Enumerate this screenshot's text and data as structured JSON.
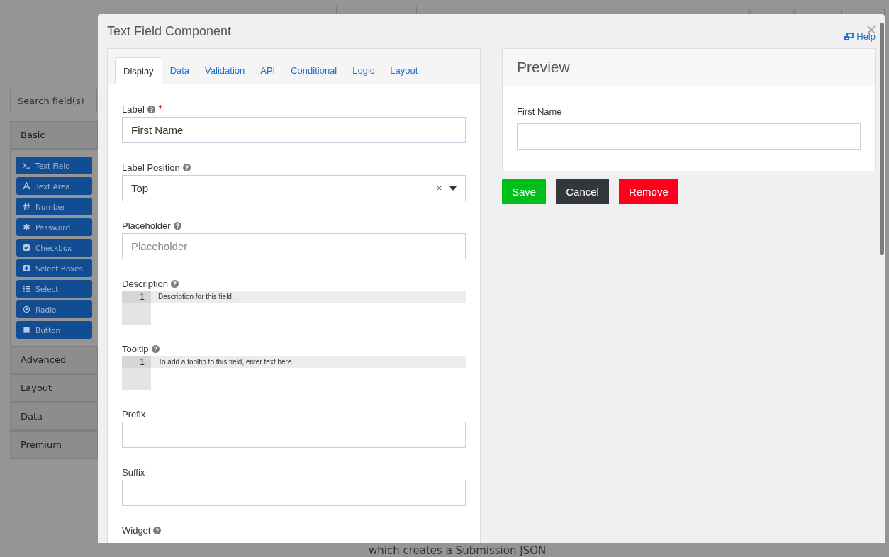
{
  "builder": {
    "search": {
      "placeholder": "Search field(s)"
    },
    "groups": [
      {
        "label": "Basic",
        "items": [
          {
            "label": "Text Field"
          },
          {
            "label": "Text Area"
          },
          {
            "label": "Number"
          },
          {
            "label": "Password"
          },
          {
            "label": "Checkbox"
          },
          {
            "label": "Select Boxes"
          },
          {
            "label": "Select"
          },
          {
            "label": "Radio"
          },
          {
            "label": "Button"
          }
        ]
      },
      {
        "label": "Advanced"
      },
      {
        "label": "Layout"
      },
      {
        "label": "Data"
      },
      {
        "label": "Premium"
      }
    ],
    "footer_text": "which creates a Submission JSON"
  },
  "dialog": {
    "title": "Text Field Component",
    "help_link": "Help",
    "tabs": [
      {
        "label": "Display",
        "selected": true
      },
      {
        "label": "Data",
        "selected": false
      },
      {
        "label": "Validation",
        "selected": false
      },
      {
        "label": "API",
        "selected": false
      },
      {
        "label": "Conditional",
        "selected": false
      },
      {
        "label": "Logic",
        "selected": false
      },
      {
        "label": "Layout",
        "selected": false
      }
    ],
    "fields": [
      {
        "kind": "input",
        "label": "Label",
        "help": true,
        "required": true,
        "value": "First Name"
      },
      {
        "kind": "select",
        "label": "Label Position",
        "help": true,
        "value": "Top"
      },
      {
        "kind": "input",
        "label": "Placeholder",
        "help": true,
        "placeholder": "Placeholder"
      },
      {
        "kind": "code",
        "label": "Description",
        "help": true,
        "line_number": "1",
        "value": "Description for this field."
      },
      {
        "kind": "code",
        "label": "Tooltip",
        "help": true,
        "line_number": "1",
        "value": "To add a tooltip to this field, enter text here."
      },
      {
        "kind": "input",
        "label": "Prefix",
        "help": false
      },
      {
        "kind": "input",
        "label": "Suffix",
        "help": false
      },
      {
        "kind": "heading",
        "label": "Widget",
        "help": true
      }
    ],
    "preview": {
      "title": "Preview",
      "field_label": "First Name"
    },
    "buttons": [
      {
        "label": "Save",
        "kind": "success"
      },
      {
        "label": "Cancel",
        "kind": "dark"
      },
      {
        "label": "Remove",
        "kind": "danger"
      }
    ]
  }
}
